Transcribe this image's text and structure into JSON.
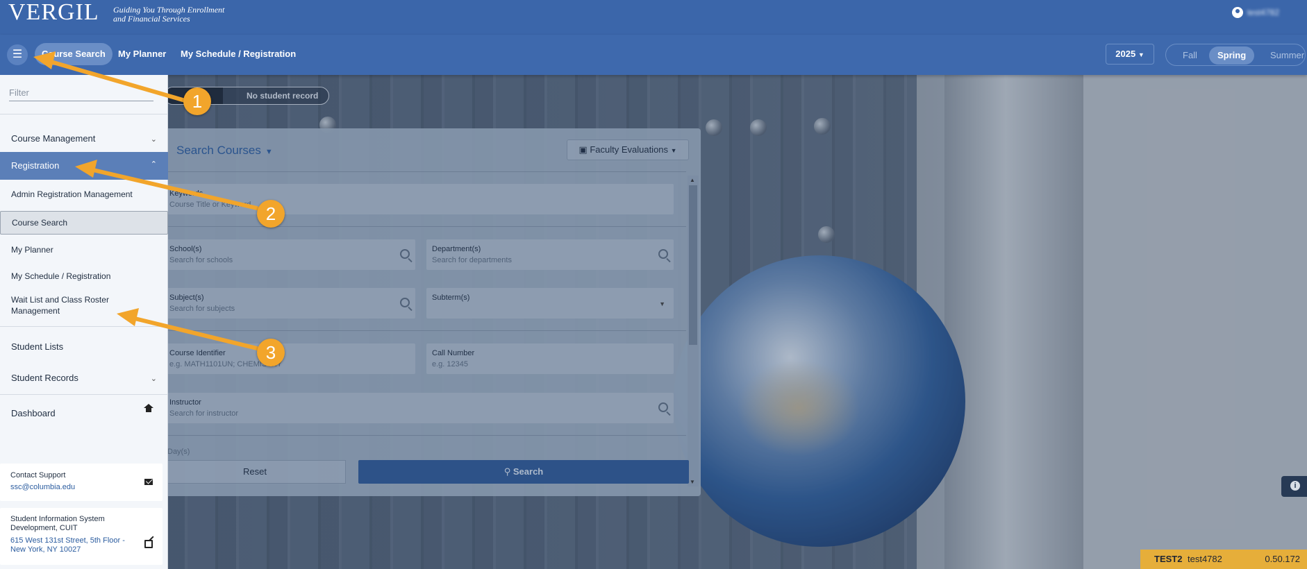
{
  "header": {
    "logo_text": "VERGIL",
    "tagline_line1": "Guiding You Through Enrollment",
    "tagline_line2": "and Financial Services",
    "user_name": "test4782"
  },
  "nav": {
    "tabs": [
      {
        "label": "Course Search"
      },
      {
        "label": "My Planner"
      },
      {
        "label": "My Schedule / Registration"
      }
    ],
    "year": "2025",
    "terms": [
      {
        "label": "Fall"
      },
      {
        "label": "Spring"
      },
      {
        "label": "Summer"
      }
    ]
  },
  "student_record": "No student record",
  "sidebar": {
    "filter_placeholder": "Filter",
    "course_management": "Course Management",
    "registration": "Registration",
    "registration_items": [
      {
        "label": "Admin Registration Management"
      },
      {
        "label": "Course Search"
      },
      {
        "label": "My Planner"
      },
      {
        "label": "My Schedule / Registration"
      },
      {
        "label": "Wait List and Class Roster",
        "label2": "Management"
      }
    ],
    "student_lists": "Student Lists",
    "student_records": "Student Records",
    "dashboard": "Dashboard",
    "contact": {
      "title": "Contact Support",
      "email": "ssc@columbia.edu"
    },
    "sis": {
      "title1": "Student Information System",
      "title2": "Development, CUIT",
      "addr1": "615 West 131st Street, 5th Floor -",
      "addr2": "New York, NY 10027"
    }
  },
  "panel": {
    "title": "Search Courses",
    "faculty_button": "Faculty Evaluations",
    "keywords_label": "Keywords",
    "keywords_placeholder": "Course Title or Keyword",
    "schools_label": "School(s)",
    "schools_placeholder": "Search for schools",
    "departments_label": "Department(s)",
    "departments_placeholder": "Search for departments",
    "subjects_label": "Subject(s)",
    "subjects_placeholder": "Search for subjects",
    "subterm_label": "Subterm(s)",
    "course_id_label": "Course Identifier",
    "course_id_placeholder": "e.g. MATH1101UN; CHEMISTRY",
    "call_number_label": "Call Number",
    "call_number_placeholder": "e.g. 12345",
    "instructor_label": "Instructor",
    "instructor_placeholder": "Search for instructor",
    "days_label": "Day(s)",
    "reset": "Reset",
    "search": "Search"
  },
  "env": {
    "name": "TEST2",
    "user": "test4782",
    "version": "0.50.172"
  },
  "annotations": [
    "1",
    "2",
    "3"
  ],
  "colors": {
    "header_blue": "#3b66aa",
    "accent_orange": "#f2a52b",
    "env_yellow": "#e6ae3a"
  }
}
